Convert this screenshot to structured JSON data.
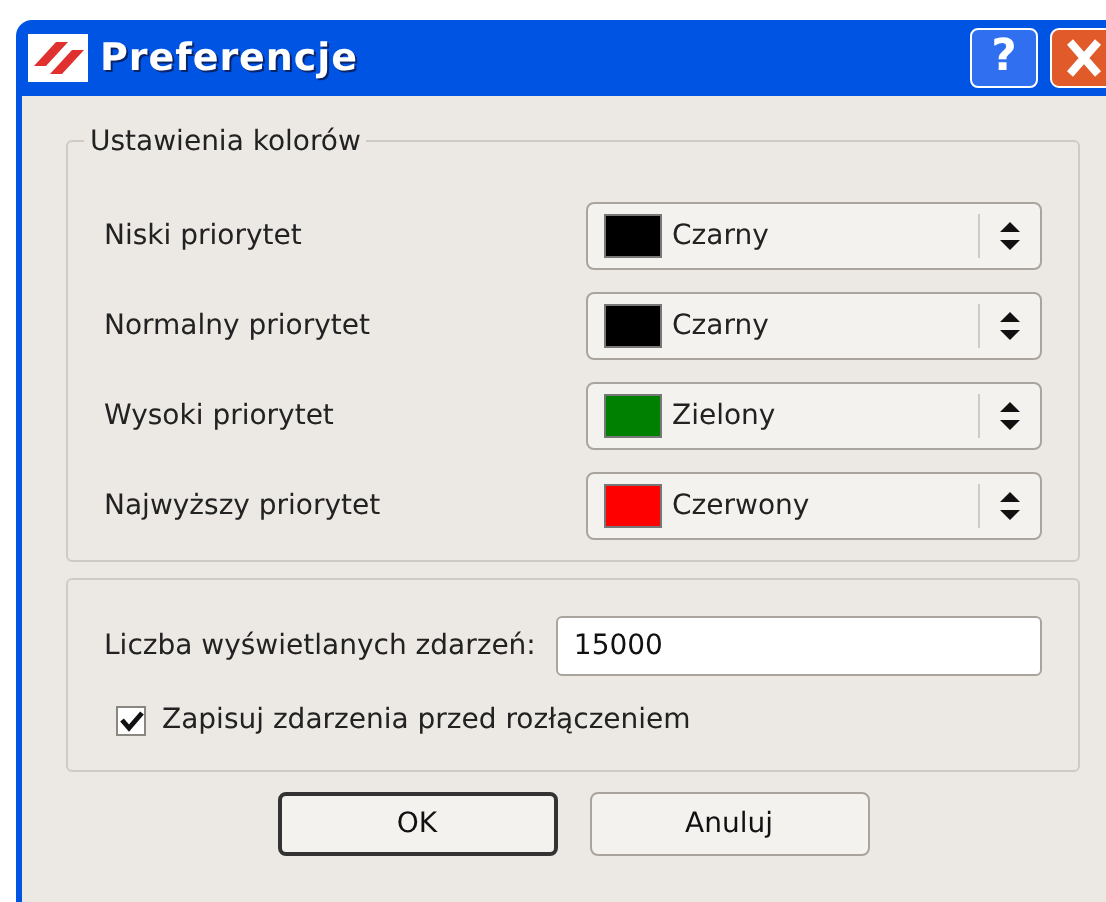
{
  "window": {
    "title": "Preferencje",
    "help_button": "?"
  },
  "colors_group": {
    "title": "Ustawienia kolorów",
    "rows": [
      {
        "label": "Niski priorytet",
        "value": "Czarny",
        "color": "#000000"
      },
      {
        "label": "Normalny priorytet",
        "value": "Czarny",
        "color": "#000000"
      },
      {
        "label": "Wysoki priorytet",
        "value": "Zielony",
        "color": "#008000"
      },
      {
        "label": "Najwyższy priorytet",
        "value": "Czerwony",
        "color": "#ff0000"
      }
    ]
  },
  "events": {
    "count_label": "Liczba wyświetlanych zdarzeń:",
    "count_value": "15000",
    "save_label": "Zapisuj zdarzenia przed rozłączeniem",
    "save_checked": true
  },
  "buttons": [
    {
      "label": "OK",
      "default": true
    },
    {
      "label": "Anuluj",
      "default": false
    }
  ]
}
